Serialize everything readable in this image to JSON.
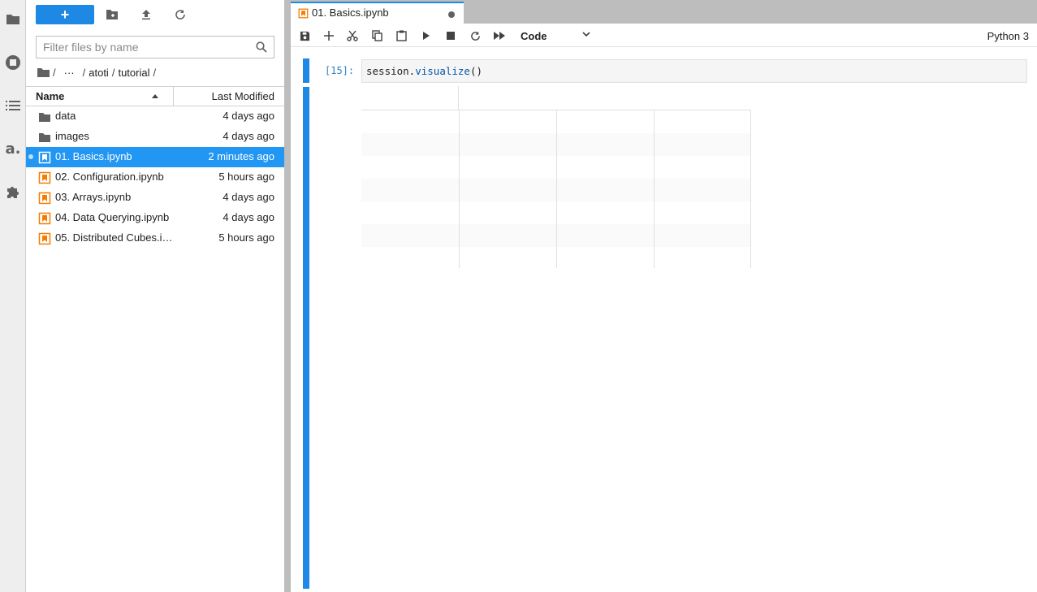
{
  "activity_bar": {
    "items": [
      {
        "icon": "folder-icon"
      },
      {
        "icon": "running-sessions-icon"
      },
      {
        "icon": "table-of-contents-icon"
      },
      {
        "icon": "atoti-logo-icon",
        "label": "a."
      },
      {
        "icon": "extension-puzzle-icon"
      }
    ]
  },
  "file_browser": {
    "new_button_label": "+",
    "filter_placeholder": "Filter files by name",
    "breadcrumbs": {
      "root": "/",
      "ellipsis": "···",
      "parts": [
        "atoti",
        "tutorial"
      ],
      "sep": "/"
    },
    "columns": {
      "name": "Name",
      "modified": "Last Modified"
    },
    "items": [
      {
        "name": "data",
        "modified": "4 days ago",
        "type": "folder"
      },
      {
        "name": "images",
        "modified": "4 days ago",
        "type": "folder"
      },
      {
        "name": "01. Basics.ipynb",
        "modified": "2 minutes ago",
        "type": "notebook"
      },
      {
        "name": "02. Configuration.ipynb",
        "modified": "5 hours ago",
        "type": "notebook"
      },
      {
        "name": "03. Arrays.ipynb",
        "modified": "4 days ago",
        "type": "notebook"
      },
      {
        "name": "04. Data Querying.ipynb",
        "modified": "4 days ago",
        "type": "notebook"
      },
      {
        "name": "05. Distributed Cubes.i…",
        "modified": "5 hours ago",
        "type": "notebook"
      }
    ]
  },
  "tab": {
    "label": "01. Basics.ipynb"
  },
  "toolbar": {
    "cell_type": "Code",
    "kernel": "Python 3"
  },
  "cell": {
    "prompt": "[15]:",
    "code_obj": "session.",
    "code_fn": "visualize",
    "code_args": "()"
  },
  "colors": {
    "accent": "#1e88e5",
    "selected_row": "#2196f3",
    "notebook_icon": "#f57c00"
  }
}
